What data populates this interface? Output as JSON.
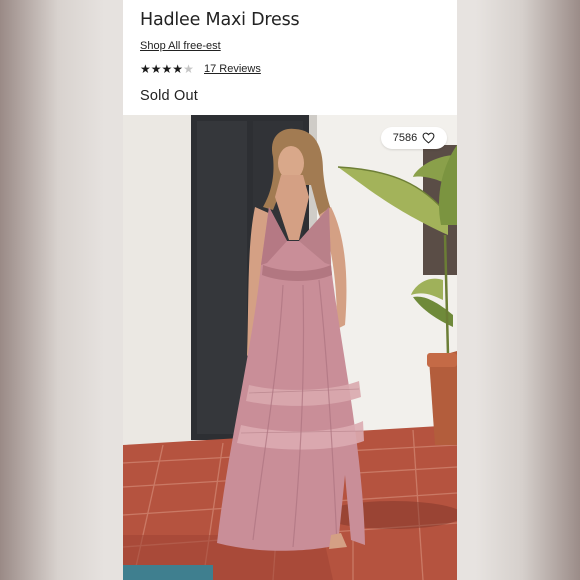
{
  "product": {
    "title": "Hadlee Maxi Dress",
    "shop_link": "Shop All free-est",
    "rating": 4,
    "rating_max": 5,
    "reviews_label": "17 Reviews",
    "status": "Sold Out"
  },
  "likes": {
    "count": "7586",
    "icon": "heart-outline-icon"
  },
  "photo": {
    "subject": "product-photo",
    "dress_color": "#c88f9a",
    "wall_color": "#f3f1ee",
    "door_color": "#2e3033",
    "floor_color": "#b4503c"
  }
}
